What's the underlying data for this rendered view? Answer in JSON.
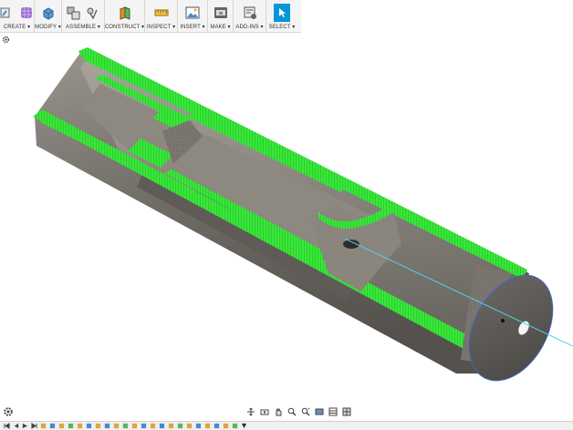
{
  "toolbar": {
    "groups": [
      {
        "label": "CREATE ▾"
      },
      {
        "label": "MODIFY ▾"
      },
      {
        "label": "ASSEMBLE ▾"
      },
      {
        "label": "CONSTRUCT ▾"
      },
      {
        "label": "INSPECT ▾"
      },
      {
        "label": "INSERT ▾"
      },
      {
        "label": "MAKE ▾"
      },
      {
        "label": "ADD-INS ▾"
      },
      {
        "label": "SELECT ▾"
      }
    ]
  },
  "colors": {
    "accent": "#0696d7",
    "section_fill": "#39e83a",
    "body_gray": "#7a7670"
  },
  "icons": [
    "sketch-icon",
    "form-icon",
    "push-pull-icon",
    "new-component-icon",
    "joint-icon",
    "offset-plane-icon",
    "measure-icon",
    "insert-image-icon",
    "3d-print-icon",
    "scripts-icon",
    "select-arrow-icon",
    "settings-gear-icon",
    "orbit-icon",
    "pan-icon",
    "zoom-icon",
    "fit-icon",
    "display-settings-icon",
    "grid-icon",
    "viewports-icon"
  ]
}
